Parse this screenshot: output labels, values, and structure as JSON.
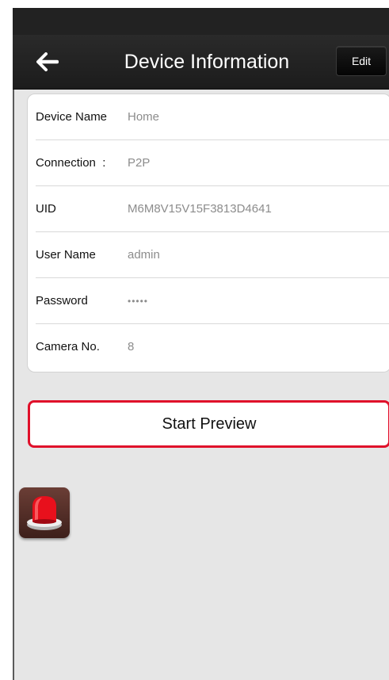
{
  "header": {
    "title": "Device Information",
    "edit_label": "Edit"
  },
  "icons": {
    "back": "left-arrow-icon",
    "alarm": "siren-alarm-icon"
  },
  "device_info": {
    "rows": [
      {
        "label": "Device Name",
        "value": "Home"
      },
      {
        "label": "Connection  :",
        "value": "P2P"
      },
      {
        "label": "UID",
        "value": "M6M8V15V15F3813D4641"
      },
      {
        "label": "User Name",
        "value": "admin"
      },
      {
        "label": "Password",
        "value": "•••••"
      },
      {
        "label": "Camera No.",
        "value": "8"
      }
    ]
  },
  "actions": {
    "start_preview_label": "Start Preview"
  },
  "colors": {
    "nav_background": "#1c1c1c",
    "highlight_border": "#e0102a",
    "alarm_red": "#e8101c"
  }
}
